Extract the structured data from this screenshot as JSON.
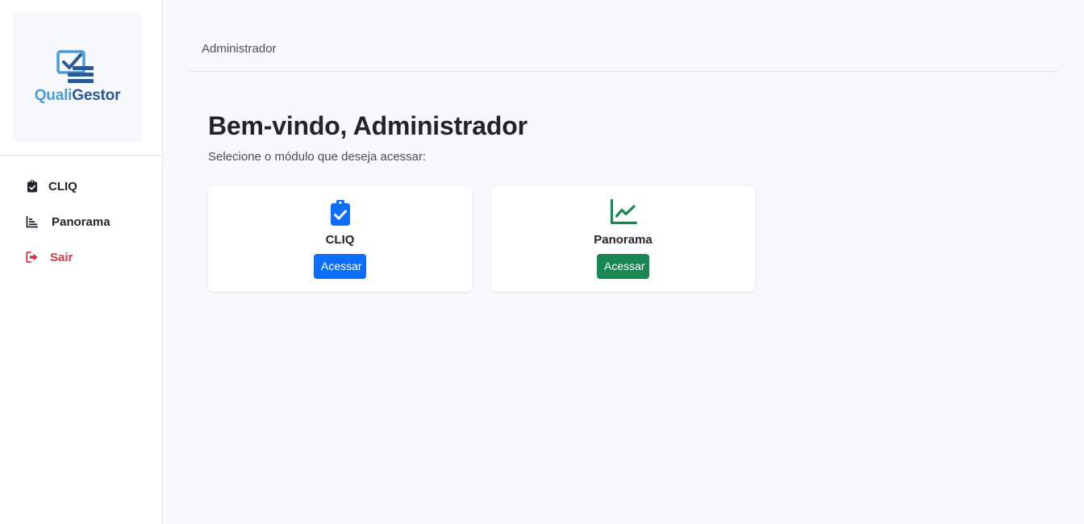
{
  "brand": {
    "name_part1": "Quali",
    "name_part2": "Gestor",
    "logo_icon": "checklist-monitor-icon",
    "colors": {
      "light": "#4a9bd6",
      "dark": "#2a5a95"
    }
  },
  "sidebar": {
    "items": [
      {
        "label": "CLIQ",
        "icon": "clipboard-check-icon"
      },
      {
        "label": "Panorama",
        "icon": "bar-chart-icon"
      },
      {
        "label": "Sair",
        "icon": "sign-out-icon",
        "color": "#dc3545"
      }
    ]
  },
  "topbar": {
    "user": "Administrador"
  },
  "main": {
    "welcome": "Bem-vindo, Administrador",
    "subtitle": "Selecione o módulo que deseja acessar:",
    "modules": [
      {
        "title": "CLIQ",
        "icon": "clipboard-check-icon",
        "button": "Acessar",
        "color": "#0d6efd"
      },
      {
        "title": "Panorama",
        "icon": "line-chart-icon",
        "button": "Acessar",
        "color": "#198754"
      }
    ]
  }
}
